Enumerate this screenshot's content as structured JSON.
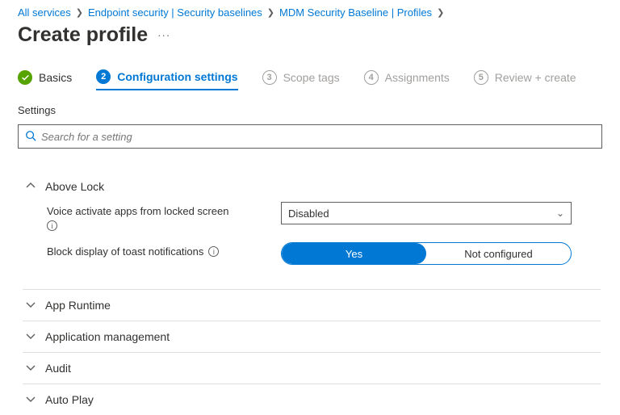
{
  "breadcrumb": {
    "items": [
      {
        "label": "All services"
      },
      {
        "label": "Endpoint security | Security baselines"
      },
      {
        "label": "MDM Security Baseline | Profiles"
      }
    ]
  },
  "header": {
    "title": "Create profile"
  },
  "stepper": {
    "steps": [
      {
        "num": "✓",
        "label": "Basics",
        "state": "done"
      },
      {
        "num": "2",
        "label": "Configuration settings",
        "state": "current"
      },
      {
        "num": "3",
        "label": "Scope tags",
        "state": "pending"
      },
      {
        "num": "4",
        "label": "Assignments",
        "state": "pending"
      },
      {
        "num": "5",
        "label": "Review + create",
        "state": "pending"
      }
    ]
  },
  "settings_label": "Settings",
  "search": {
    "placeholder": "Search for a setting"
  },
  "groups": {
    "above_lock": {
      "title": "Above Lock",
      "voice_label": "Voice activate apps from locked screen",
      "voice_value": "Disabled",
      "toast_label": "Block display of toast notifications",
      "toast_options": {
        "yes": "Yes",
        "no": "Not configured"
      },
      "toast_selected": "yes"
    },
    "app_runtime": {
      "title": "App Runtime"
    },
    "app_mgmt": {
      "title": "Application management"
    },
    "audit": {
      "title": "Audit"
    },
    "autoplay": {
      "title": "Auto Play"
    }
  }
}
